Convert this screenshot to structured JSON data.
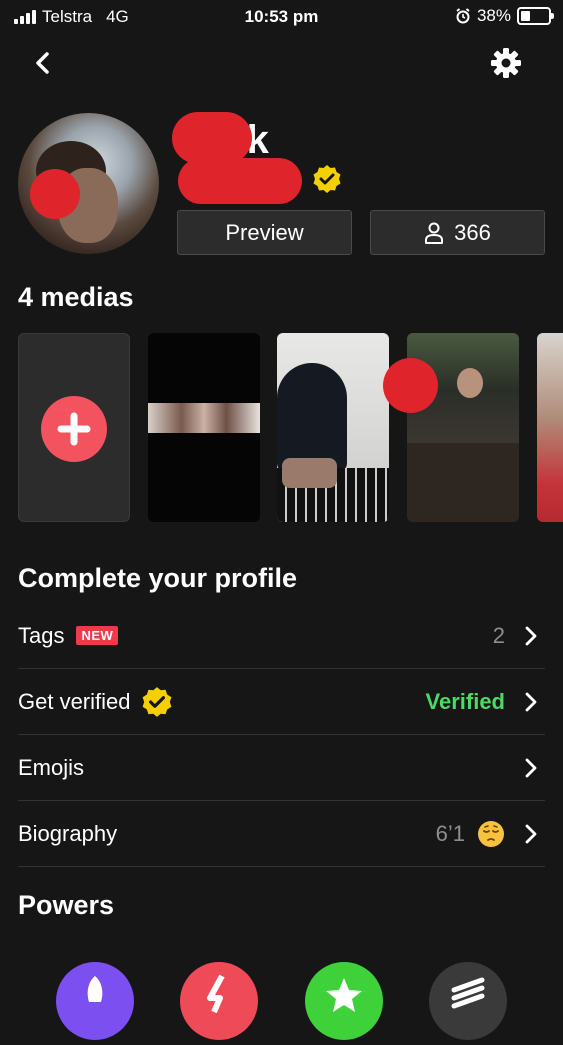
{
  "status_bar": {
    "carrier": "Telstra",
    "network": "4G",
    "time": "10:53 pm",
    "battery": "38%"
  },
  "header": {
    "back_icon": "chevron-left-icon",
    "settings_icon": "gear-icon"
  },
  "profile": {
    "name_visible": "rk",
    "verified_icon": "verified-badge-icon",
    "preview_label": "Preview",
    "followers_count": "366",
    "followers_icon": "person-icon"
  },
  "media": {
    "title": "4 medias",
    "add_icon": "plus-icon"
  },
  "complete_profile": {
    "title": "Complete your profile",
    "rows": [
      {
        "label": "Tags",
        "badge": "NEW",
        "value": "2"
      },
      {
        "label": "Get verified",
        "value": "Verified"
      },
      {
        "label": "Emojis",
        "value": ""
      },
      {
        "label": "Biography",
        "value": "6’1"
      }
    ]
  },
  "powers": {
    "title": "Powers"
  },
  "colors": {
    "background": "#161616",
    "accent_red": "#f2535f",
    "verified_green": "#4cd964",
    "badge_yellow": "#f5d000",
    "new_badge": "#ef3a4c"
  }
}
